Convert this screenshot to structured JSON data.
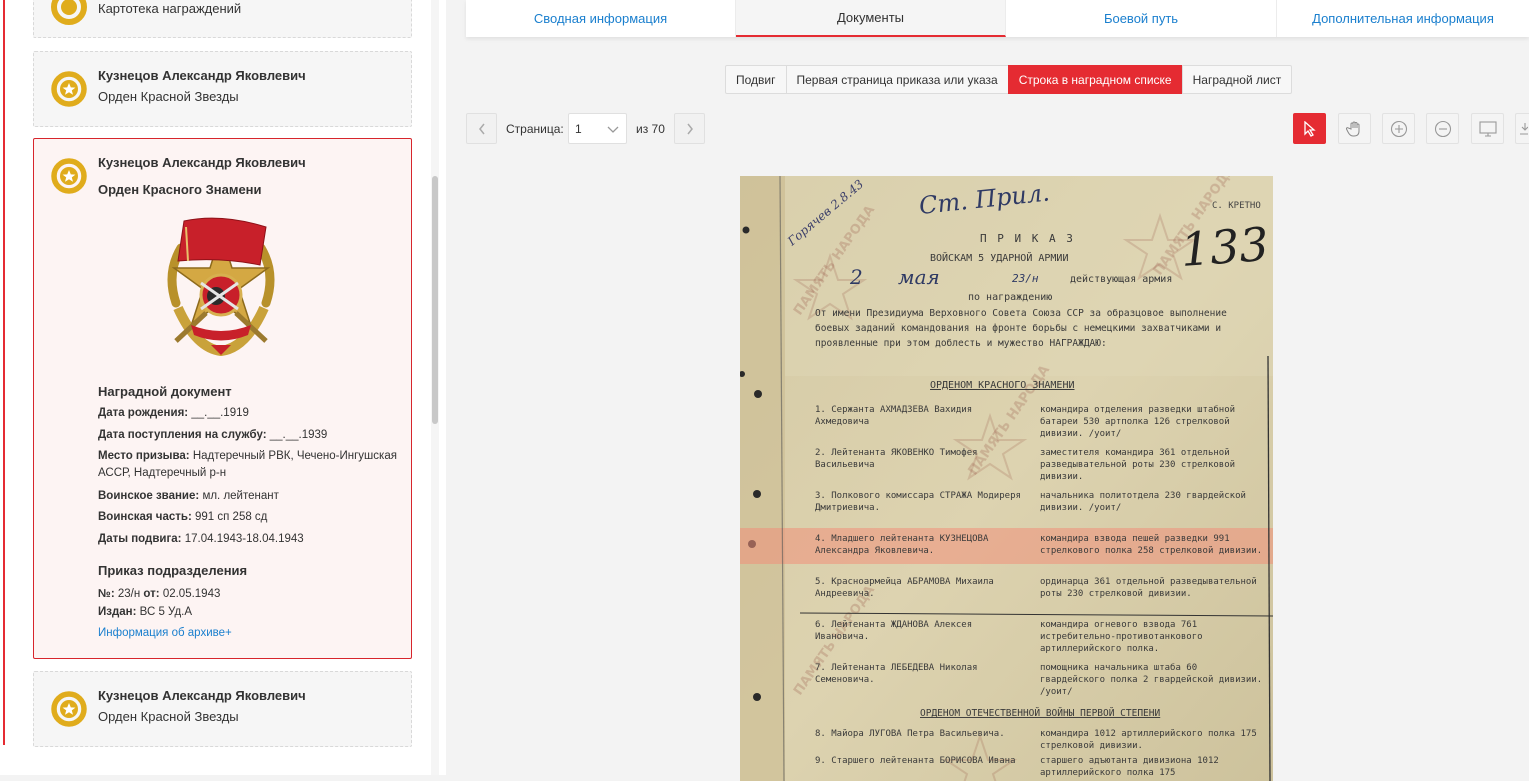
{
  "left": {
    "card_top": {
      "award": "Картотека награждений"
    },
    "card1": {
      "name": "Кузнецов Александр Яковлевич",
      "award": "Орден Красной Звезды"
    },
    "card_active": {
      "name": "Кузнецов Александр Яковлевич",
      "award": "Орден Красного Знамени",
      "doc_title": "Наградной документ",
      "birth_label": "Дата рождения:",
      "birth_value": "__.__.1919",
      "service_label": "Дата поступления на службу:",
      "service_value": "__.__.1939",
      "draft_label": "Место призыва:",
      "draft_value": "Надтеречный РВК, Чечено-Ингушская АССР, Надтеречный р-н",
      "rank_label": "Воинское звание:",
      "rank_value": "мл. лейтенант",
      "unit_label": "Воинская часть:",
      "unit_value": "991 сп 258 сд",
      "feat_label": "Даты подвига:",
      "feat_value": "17.04.1943-18.04.1943",
      "order_title": "Приказ подразделения",
      "no_label": "№:",
      "no_value": "23/н",
      "from_label": "от:",
      "from_value": "02.05.1943",
      "issued_label": "Издан:",
      "issued_value": "ВС 5 Уд.А",
      "archive_link": "Информация об архиве+"
    },
    "card2": {
      "name": "Кузнецов Александр Яковлевич",
      "award": "Орден Красной Звезды"
    }
  },
  "tabs": [
    "Сводная информация",
    "Документы",
    "Боевой путь",
    "Дополнительная информация"
  ],
  "doc_types": [
    "Подвиг",
    "Первая страница приказа или указа",
    "Строка в наградном списке",
    "Наградной лист"
  ],
  "pager": {
    "label": "Страница:",
    "value": "1",
    "total": "из 70"
  },
  "document": {
    "handwritten_top": "Ст. Прил.",
    "handwritten_corner": "Горячев 2.8.43",
    "page_number": "133",
    "secret_mark": "С. КРЕТНО",
    "title": "П Р И К А З",
    "subtitle": "ВОЙСКАМ 5 УДАРНОЙ АРМИИ",
    "date_line_day": "2",
    "date_line_month": "мая",
    "date_line_num": "23/н",
    "date_line_rest": "действующая армия",
    "about": "по награждению",
    "preamble": "От имени Президиума Верховного Совета Союза ССР за образцовое выполнение боевых заданий командования на фронте борьбы с немецкими захватчиками и проявленные при этом доблесть и мужество НАГРАЖДАЮ:",
    "section1": "ОРДЕНОМ КРАСНОГО ЗНАМЕНИ",
    "rows": [
      {
        "name": "1. Сержанта АХМАДЗЕВА Вахидия Ахмедовича",
        "desc": "командира отделения разведки штабной батареи 530 артполка 126 стрелковой дивизии. /уоит/"
      },
      {
        "name": "2. Лейтенанта ЯКОВЕНКО Тимофея Васильевича",
        "desc": "заместителя командира 361 отдельной разведывательной роты 230 стрелковой дивизии."
      },
      {
        "name": "3. Полкового комиссара СТРАЖА Модиреря Дмитриевича.",
        "desc": "начальника политотдела 230 гвардейской дивизии. /уоит/"
      },
      {
        "name": "4. Младшего лейтенанта КУЗНЕЦОВА Александра Яковлевича.",
        "desc": "командира взвода пешей разведки 991 стрелкового полка 258 стрелковой дивизии."
      },
      {
        "name": "5. Красноармейца АБРАМОВА Михаила Андреевича.",
        "desc": "ординарца 361 отдельной разведывательной роты 230 стрелковой дивизии."
      },
      {
        "name": "6. Лейтенанта ЖДАНОВА Алексея Ивановича.",
        "desc": "командира огневого взвода 761 истребительно-противотанкового артиллерийского полка."
      },
      {
        "name": "7. Лейтенанта ЛЕБЕДЕВА Николая Семеновича.",
        "desc": "помощника начальника штаба 60 гвардейского полка 2 гвардейской дивизии. /уоит/"
      }
    ],
    "section2": "ОРДЕНОМ ОТЕЧЕСТВЕННОЙ ВОЙНЫ ПЕРВОЙ СТЕПЕНИ",
    "rows2": [
      {
        "name": "8. Майора ЛУГОВА Петра Васильевича.",
        "desc": "командира 1012 артиллерийского полка 175 стрелковой дивизии."
      },
      {
        "name": "9. Старшего лейтенанта БОРИСОВА Ивана",
        "desc": "старшего адъютанта дивизиона 1012 артиллерийского полка 175"
      }
    ],
    "watermark": "ПАМЯТЬ НАРОДА"
  },
  "colors": {
    "accent": "#e52b32",
    "link": "#1a7fce",
    "medal": "#e0ac1c"
  }
}
